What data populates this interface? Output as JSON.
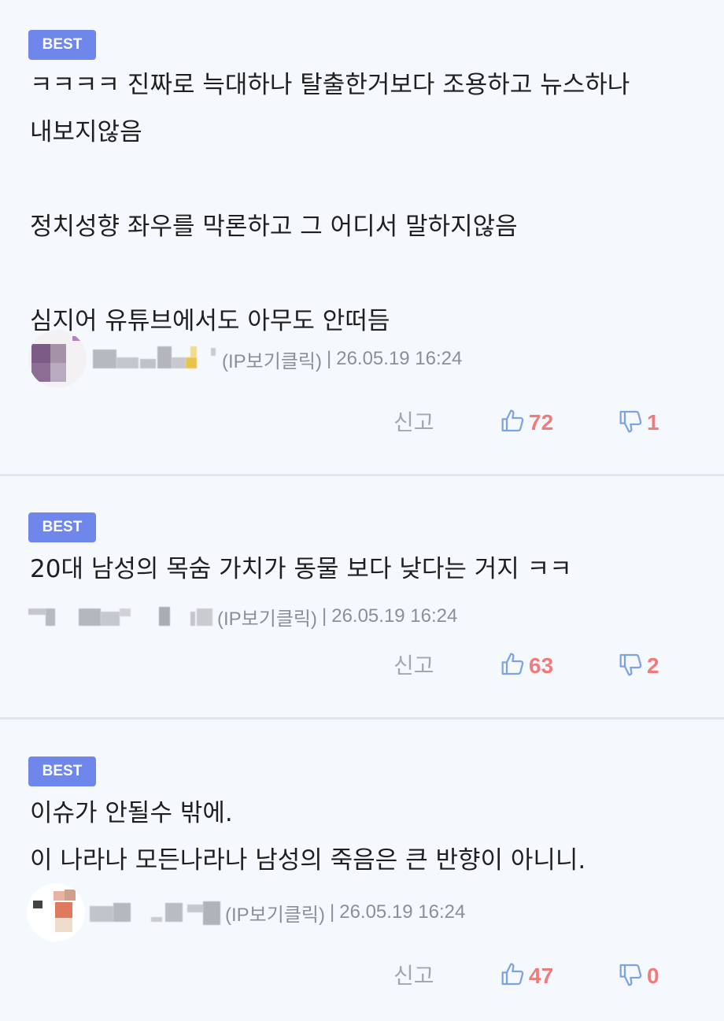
{
  "comments": [
    {
      "badge": "BEST",
      "body": "ㅋㅋㅋㅋ 진짜로 늑대하나 탈출한거보다 조용하고 뉴스하나\n내보지않음\n\n정치성향 좌우를 막론하고 그 어디서 말하지않음\n\n심지어 유튜브에서도 아무도 안떠듬",
      "ip_label": "(IP보기클릭)",
      "separator": "|",
      "timestamp": "26.05.19 16:24",
      "report_label": "신고",
      "likes": "72",
      "dislikes": "1"
    },
    {
      "badge": "BEST",
      "body": "20대 남성의 목숨 가치가 동물 보다 낮다는 거지 ㅋㅋ",
      "ip_label": "(IP보기클릭)",
      "separator": "|",
      "timestamp": "26.05.19 16:24",
      "report_label": "신고",
      "likes": "63",
      "dislikes": "2"
    },
    {
      "badge": "BEST",
      "body": "이슈가 안될수 밖에.\n이 나라나 모든나라나 남성의 죽음은 큰 반향이 아니니.",
      "ip_label": "(IP보기클릭)",
      "separator": "|",
      "timestamp": "26.05.19 16:24",
      "report_label": "신고",
      "likes": "47",
      "dislikes": "0"
    }
  ],
  "icons": {
    "like": "thumbs-up-icon",
    "dislike": "thumbs-down-icon"
  },
  "colors": {
    "badge": "#6f86ea",
    "count": "#ef7b7b",
    "icon": "#7ca4e2",
    "meta": "#8a8f99",
    "background": "#f5f8fd"
  }
}
